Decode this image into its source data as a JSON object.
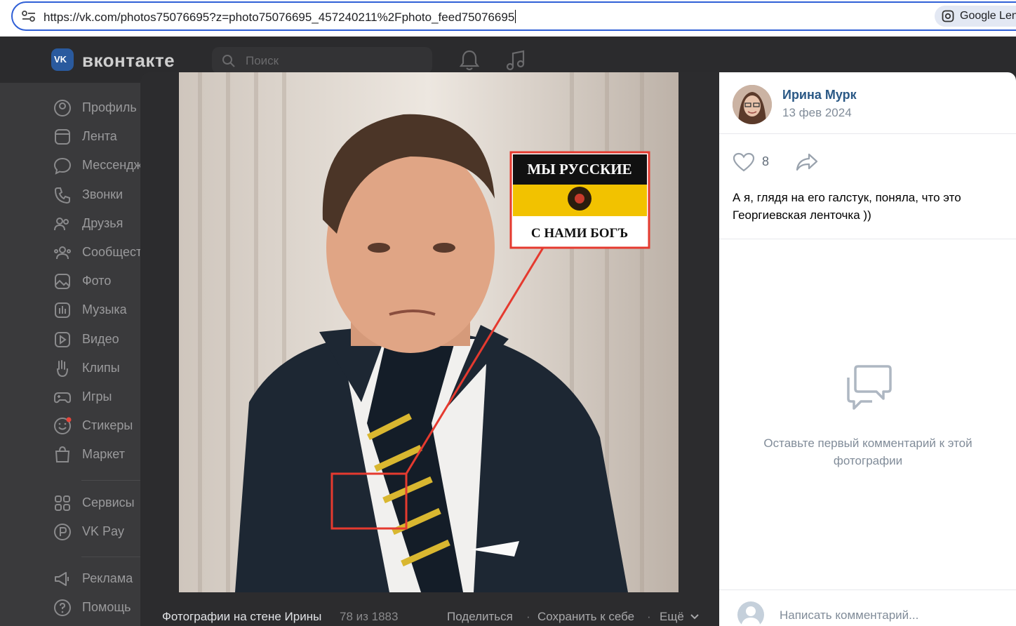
{
  "browser": {
    "url": "https://vk.com/photos75076695?z=photo75076695_457240211%2Fphoto_feed75076695",
    "lens_label": "Google Lens"
  },
  "header": {
    "logo_text": "вконтакте",
    "search_placeholder": "Поиск"
  },
  "sidebar": {
    "items": [
      {
        "label": "Профиль",
        "icon": "profile-icon"
      },
      {
        "label": "Лента",
        "icon": "feed-icon"
      },
      {
        "label": "Мессенджер",
        "icon": "messenger-icon"
      },
      {
        "label": "Звонки",
        "icon": "phone-icon"
      },
      {
        "label": "Друзья",
        "icon": "friends-icon"
      },
      {
        "label": "Сообщества",
        "icon": "communities-icon"
      },
      {
        "label": "Фото",
        "icon": "photo-icon"
      },
      {
        "label": "Музыка",
        "icon": "music-icon"
      },
      {
        "label": "Видео",
        "icon": "video-icon"
      },
      {
        "label": "Клипы",
        "icon": "clips-icon"
      },
      {
        "label": "Игры",
        "icon": "gamepad-icon"
      },
      {
        "label": "Стикеры",
        "icon": "stickers-icon"
      },
      {
        "label": "Маркет",
        "icon": "market-icon"
      }
    ],
    "items2": [
      {
        "label": "Сервисы",
        "icon": "services-icon"
      },
      {
        "label": "VK Pay",
        "icon": "vkpay-icon"
      }
    ],
    "items3": [
      {
        "label": "Реклама",
        "icon": "ads-icon"
      },
      {
        "label": "Помощь",
        "icon": "help-icon"
      }
    ]
  },
  "photo": {
    "flag_top_text": "МЫ РУССКИЕ",
    "flag_bottom_text": "С НАМИ БОГЪ",
    "flag_colors": [
      "#111111",
      "#f2c200",
      "#ffffff"
    ],
    "highlight_color": "#e53a2f"
  },
  "viewer_footer": {
    "album_title": "Фотографии на стене Ирины",
    "counter": "78 из 1883",
    "share_label": "Поделиться",
    "save_label": "Сохранить к себе",
    "more_label": "Ещё"
  },
  "post": {
    "author": "Ирина Мурк",
    "date": "13 фев 2024",
    "likes": "8",
    "caption": "А я, глядя на его галстук, поняла, что это Георгиевская ленточка ))"
  },
  "comments": {
    "empty_text": "Оставьте первый комментарий к этой фотографии",
    "input_placeholder": "Написать комментарий..."
  }
}
